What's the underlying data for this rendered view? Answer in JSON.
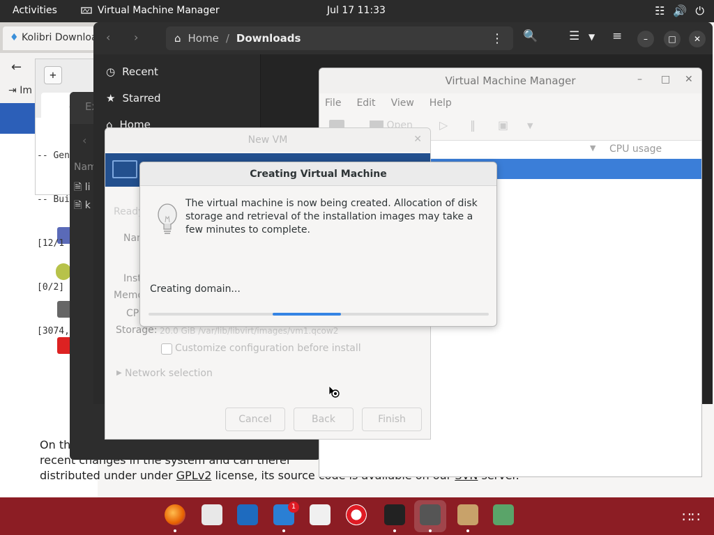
{
  "topbar": {
    "activities": "Activities",
    "app_name": "Virtual Machine Manager",
    "clock": "Jul 17  11:33"
  },
  "browser": {
    "tab_title": "Kolibri Downloa",
    "im_label": "Im",
    "footer_line1": "On th",
    "footer_line2": "recent changes in the system and can theref",
    "footer_line3_a": "distributed under under ",
    "footer_line3_link": "GPLv2",
    "footer_line3_b": " license, its source code is available on our ",
    "footer_line3_link2": "SVN",
    "footer_line3_c": " server."
  },
  "terminal": {
    "tab_label": "c",
    "lines": [
      "-- Gen",
      "-- Bui",
      "[12/1",
      "[0/2]",
      "[3074,"
    ]
  },
  "files": {
    "path_home": "Home",
    "path_sep": "/",
    "path_current": "Downloads",
    "sidebar": [
      "Recent",
      "Starred",
      "Home"
    ]
  },
  "darkdlg": {
    "tab_label": "Ex",
    "col_label": "Nam",
    "row1": "li",
    "row2": "k"
  },
  "vmm": {
    "title": "Virtual Machine Manager",
    "menu": [
      "File",
      "Edit",
      "View",
      "Help"
    ],
    "open_label": "Open",
    "cpu_usage": "CPU usage"
  },
  "newvm": {
    "title": "New VM",
    "ready": "Ready",
    "name_label": "Nam",
    "install_label": "Inst",
    "memory_label": "Memo",
    "cpu_label": "CP",
    "storage_label": "Storage:",
    "storage_value": "20.0 GiB /var/lib/libvirt/images/vm1.qcow2",
    "customize": "Customize configuration before install",
    "network": "Network selection",
    "cancel": "Cancel",
    "back": "Back",
    "finish": "Finish"
  },
  "creating": {
    "title": "Creating Virtual Machine",
    "message": "The virtual machine is now being created. Allocation of disk storage and retrieval of the installation images may take a few minutes to complete.",
    "status": "Creating domain...",
    "progress_fill_start": 0.365,
    "progress_fill_fraction": 0.2
  },
  "dock": {
    "notification_count": "1"
  },
  "colors": {
    "topbar": "#2b2b2b",
    "dock": "#8c1d24",
    "selection": "#3b7ed8",
    "progress": "#3584e4"
  }
}
